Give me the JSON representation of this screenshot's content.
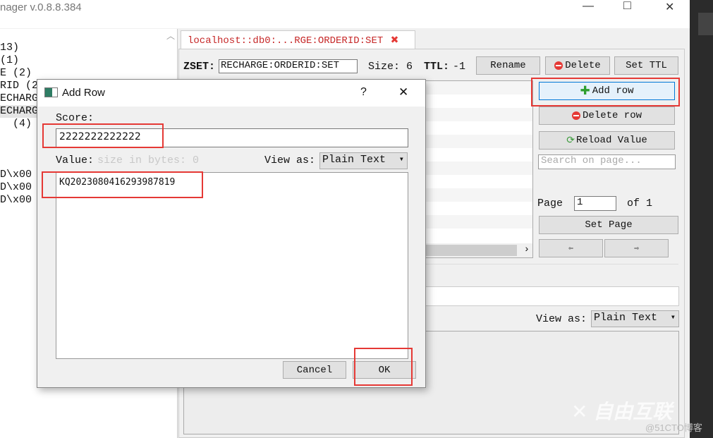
{
  "window": {
    "title": "nager v.0.8.8.384",
    "minimize": "—",
    "maximize": "□",
    "close": "✕"
  },
  "tree": {
    "items": [
      "13)",
      " (1)",
      "E (2)",
      "RID (2",
      "ECHARG",
      "ECHARG",
      "  (4)",
      "",
      "",
      "",
      "D\\x00",
      "D\\x00",
      "D\\x00"
    ]
  },
  "tab": {
    "label": "localhost::db0:...RGE:ORDERID:SET",
    "close": "✖"
  },
  "key": {
    "type_label": "ZSET:",
    "name": "RECHARGE:ORDERID:SET",
    "size_label": "Size: 6",
    "ttl_label": "TTL:",
    "ttl_value": "-1",
    "rename": "Rename",
    "delete": "Delete",
    "set_ttl": "Set TTL"
  },
  "side": {
    "add_row": "Add row",
    "delete_row": "Delete row",
    "reload": "Reload Value",
    "search_placeholder": "Search on page...",
    "page_label": "Page",
    "page_value": "1",
    "of_label": "of 1",
    "set_page": "Set Page",
    "prev": "⇦",
    "next": "⇨"
  },
  "bottom": {
    "view_as": "View as:",
    "format": "Plain Text"
  },
  "dialog": {
    "title": "Add Row",
    "help": "?",
    "close": "✕",
    "score_label": "Score:",
    "score_value": "2222222222222",
    "value_label": "Value:",
    "size_hint": "size in bytes: 0",
    "view_as": "View as:",
    "format": "Plain Text",
    "value_text": "KQ2023080416293987819",
    "cancel": "Cancel",
    "ok": "OK"
  },
  "watermark": {
    "brand": "自由互联",
    "site": "@51CTO博客"
  },
  "colors": {
    "highlight": "#e53935",
    "accent": "#0078d7"
  }
}
